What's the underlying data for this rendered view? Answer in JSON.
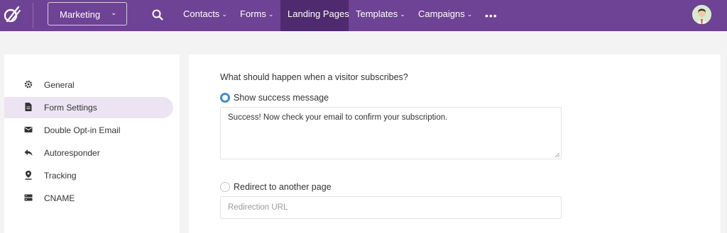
{
  "brand": {
    "logo": "sendfox-logo-icon"
  },
  "workspace": {
    "label": "Marketing",
    "icon": "chevron-down-icon"
  },
  "nav": {
    "search_icon": "search-icon",
    "items": [
      {
        "label": "Contacts",
        "caret": "⌄"
      },
      {
        "label": "Forms",
        "caret": "⌄"
      },
      {
        "label": "Landing Pages",
        "caret": ""
      },
      {
        "label": "Templates",
        "caret": "⌄"
      },
      {
        "label": "Campaigns",
        "caret": "⌄"
      }
    ],
    "active": "Landing Pages",
    "more": "•••"
  },
  "colors": {
    "topbar": "#6e4294",
    "active_nav": "#4f2a6f",
    "sidebar_active": "#ede4f3",
    "radio_on": "#3f8cdb"
  },
  "sidebar": {
    "items": [
      {
        "label": "General",
        "icon": "gear-icon"
      },
      {
        "label": "Form Settings",
        "icon": "document-icon"
      },
      {
        "label": "Double Opt-in Email",
        "icon": "envelope-icon"
      },
      {
        "label": "Autoresponder",
        "icon": "reply-icon"
      },
      {
        "label": "Tracking",
        "icon": "map-pin-icon"
      },
      {
        "label": "CNAME",
        "icon": "server-icon"
      }
    ],
    "active": "Form Settings"
  },
  "main": {
    "question": "What should happen when a visitor subscribes?",
    "options": [
      {
        "label": "Show success message",
        "selected": true
      },
      {
        "label": "Redirect to another page",
        "selected": false
      }
    ],
    "success_message": "Success! Now check your email to confirm your subscription.",
    "redirect_placeholder": "Redirection URL",
    "redirect_value": ""
  }
}
